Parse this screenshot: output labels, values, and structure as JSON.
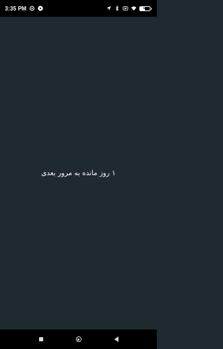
{
  "status_bar": {
    "time": "3:35 PM",
    "left_icons": [
      "notification-icon",
      "record-icon"
    ],
    "right_icons": [
      "location-icon",
      "bluetooth-icon",
      "no-sim-icon",
      "wifi-icon"
    ],
    "battery_level": "53"
  },
  "main": {
    "message": "۱ روز مانده به مرور بعدی"
  },
  "nav_bar": {
    "buttons": [
      "recents-button",
      "home-button",
      "back-button"
    ]
  },
  "colors": {
    "background": "#1f2930",
    "status_bar": "#000000",
    "nav_bar": "#000000",
    "text": "#ffffff"
  }
}
